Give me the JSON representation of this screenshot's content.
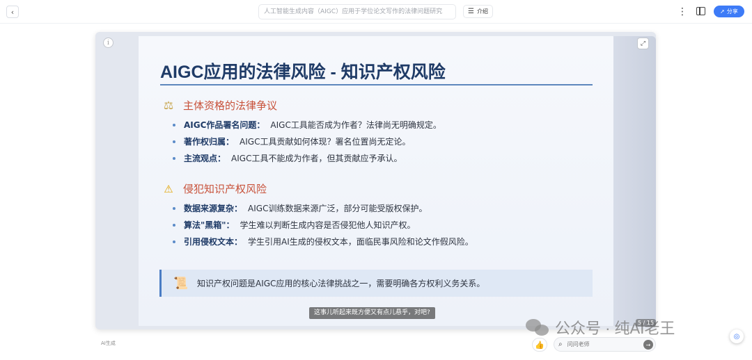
{
  "toolbar": {
    "back_icon": "chevron-left-icon",
    "doc_title": "人工智能生成内容（AIGC）应用于学位论文写作的法律问题研究",
    "intro_label": "介绍",
    "share_label": "分享"
  },
  "slide": {
    "title": "AIGC应用的法律风险 - 知识产权风险",
    "sections": [
      {
        "heading": "主体资格的法律争议",
        "icon": "scales-icon",
        "bullets": [
          {
            "key": "AIGC作品署名问题：",
            "value": "AIGC工具能否成为作者？法律尚无明确规定。"
          },
          {
            "key": "著作权归属：",
            "value": "AIGC工具贡献如何体现？署名位置尚无定论。"
          },
          {
            "key": "主流观点：",
            "value": "AIGC工具不能成为作者，但其贡献应予承认。"
          }
        ]
      },
      {
        "heading": "侵犯知识产权风险",
        "icon": "warning-icon",
        "bullets": [
          {
            "key": "数据来源复杂：",
            "value": "AIGC训练数据来源广泛，部分可能受版权保护。"
          },
          {
            "key": "算法\"黑箱\"：",
            "value": "学生难以判断生成内容是否侵犯他人知识产权。"
          },
          {
            "key": "引用侵权文本：",
            "value": "学生引用AI生成的侵权文本，面临民事风险和论文作假风险。"
          }
        ]
      }
    ],
    "callout": "知识产权问题是AIGC应用的核心法律挑战之一，需要明确各方权利义务关系。"
  },
  "player": {
    "subtitle": "这事儿听起来既方便又有点儿悬乎，对吧?",
    "page_counter": "5 / 15",
    "ai_badge": "AI生成",
    "ask_placeholder": "问问老师"
  },
  "watermark": {
    "text": "公众号 · 纯AI老王"
  },
  "colors": {
    "title": "#1f3b67",
    "section_heading": "#c8523a",
    "accent": "#3d7bf7",
    "rule": "#5d87bd"
  }
}
